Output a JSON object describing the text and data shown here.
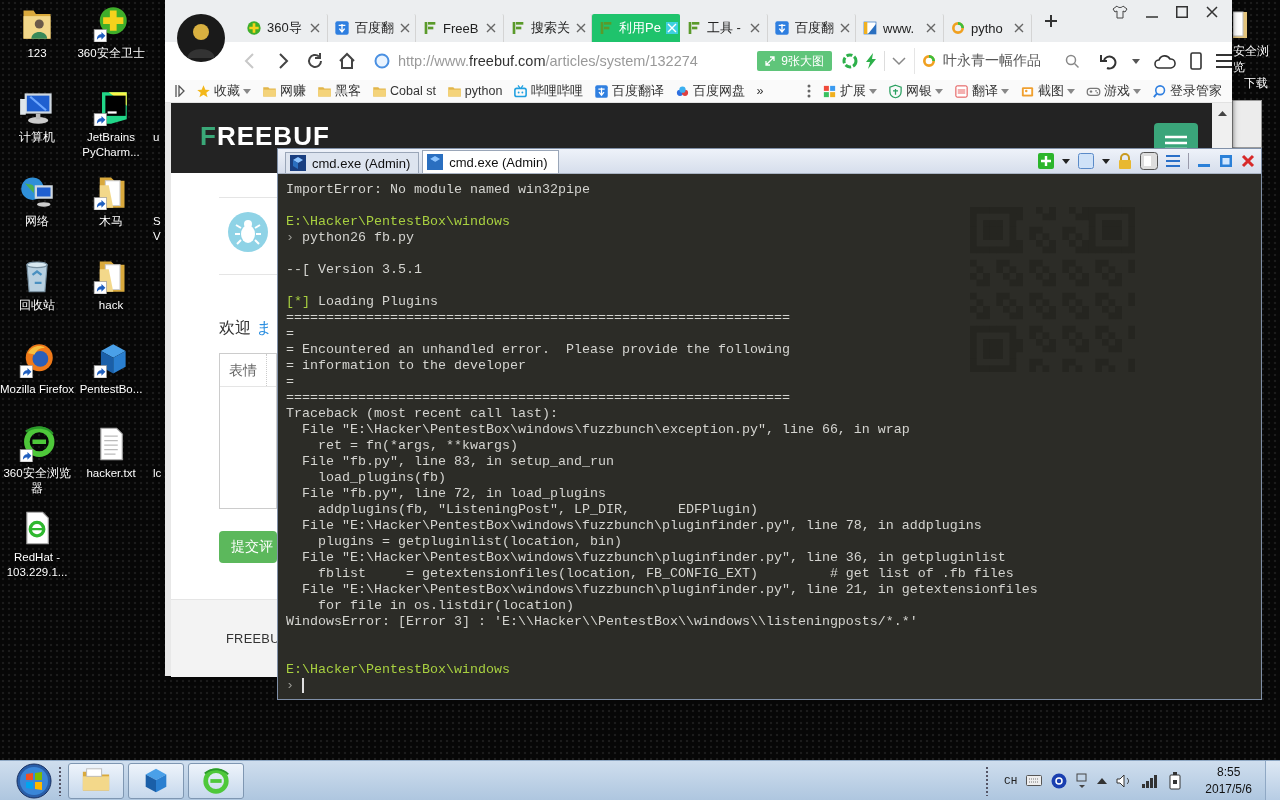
{
  "desktop": {
    "icons": [
      {
        "label": "123",
        "kind": "user-folder"
      },
      {
        "label": "360安全卫士",
        "kind": "shield"
      },
      {
        "label": "计算机",
        "kind": "computer"
      },
      {
        "label": "JetBrains PyCharm...",
        "kind": "ide"
      },
      {
        "label": "网络",
        "kind": "network"
      },
      {
        "label": "木马",
        "kind": "folder"
      },
      {
        "label": "回收站",
        "kind": "recycle"
      },
      {
        "label": "hack",
        "kind": "folder"
      },
      {
        "label": "Mozilla Firefox",
        "kind": "firefox"
      },
      {
        "label": "PentestBo...",
        "kind": "cube"
      },
      {
        "label": "360安全浏览器",
        "kind": "browser"
      },
      {
        "label": "hacker.txt",
        "kind": "text"
      },
      {
        "label": "RedHat - 103.229.1...",
        "kind": "page"
      }
    ],
    "covered_labels": [
      "u",
      "S V",
      "lc"
    ],
    "right_icon_lines": [
      "安全浏览",
      "下载"
    ]
  },
  "browser": {
    "tabs": [
      {
        "title": "360导",
        "kind": "shield",
        "selected": false
      },
      {
        "title": "百度翻",
        "kind": "translate",
        "selected": false
      },
      {
        "title": "FreeB",
        "kind": "bars",
        "selected": false
      },
      {
        "title": "搜索关",
        "kind": "bars",
        "selected": false
      },
      {
        "title": "利用Pe",
        "kind": "bars",
        "selected": true
      },
      {
        "title": "工具 -",
        "kind": "bars",
        "selected": false
      },
      {
        "title": "百度翻",
        "kind": "translate",
        "selected": false
      },
      {
        "title": "www.",
        "kind": "page",
        "selected": false
      },
      {
        "title": "pytho",
        "kind": "ring",
        "selected": false
      }
    ],
    "nav": [
      {
        "kind": "back",
        "disabled": true
      },
      {
        "kind": "forward",
        "disabled": false
      },
      {
        "kind": "refresh",
        "disabled": false
      },
      {
        "kind": "home",
        "disabled": false
      }
    ],
    "url": {
      "prefix": "http://www.",
      "domain": "freebuf.com",
      "path": "/articles/system/132274"
    },
    "image_badge": "9张大图",
    "search": {
      "value": "叶永青一幅作品"
    },
    "bookmarks": [
      {
        "label": "收藏",
        "kind": "star",
        "menu": true
      },
      {
        "label": "网赚",
        "kind": "folder",
        "menu": false
      },
      {
        "label": "黑客",
        "kind": "folder",
        "menu": false
      },
      {
        "label": "Cobal st",
        "kind": "folder",
        "menu": false
      },
      {
        "label": "python",
        "kind": "folder",
        "menu": false
      },
      {
        "label": "哔哩哔哩",
        "kind": "tv",
        "menu": false
      },
      {
        "label": "百度翻译",
        "kind": "translate",
        "menu": false
      },
      {
        "label": "百度网盘",
        "kind": "cloud",
        "menu": false
      }
    ],
    "bookmark_overflow": "»",
    "tools": [
      {
        "label": "扩展",
        "kind": "grid",
        "menu": true
      },
      {
        "label": "网银",
        "kind": "wallet",
        "menu": true
      },
      {
        "label": "翻译",
        "kind": "pdf",
        "menu": true
      },
      {
        "label": "截图",
        "kind": "crop",
        "menu": true
      },
      {
        "label": "游戏",
        "kind": "gamepad",
        "menu": true
      },
      {
        "label": "登录管家",
        "kind": "user",
        "menu": false
      }
    ],
    "page": {
      "logo": "FREEBUF",
      "greeting": "欢迎",
      "user_link": "ま",
      "editor_tabs": [
        "表情"
      ],
      "submit": "提交评",
      "footer": "FREEBU"
    }
  },
  "console": {
    "tabs": [
      {
        "title": "cmd.exe (Admin)",
        "selected": false
      },
      {
        "title": "cmd.exe (Admin)",
        "selected": true
      }
    ],
    "lines": [
      {
        "kind": "output",
        "text": "ImportError: No module named win32pipe"
      },
      {
        "kind": "blank"
      },
      {
        "kind": "path",
        "text": "E:\\Hacker\\PentestBox\\windows"
      },
      {
        "kind": "prompt",
        "prompt": "›",
        "text": "python26 fb.py",
        "cursor": false
      },
      {
        "kind": "blank"
      },
      {
        "kind": "output",
        "text": "--[ Version 3.5.1"
      },
      {
        "kind": "blank"
      },
      {
        "kind": "status",
        "marker": "[*]",
        "text": "Loading Plugins"
      },
      {
        "kind": "output",
        "text": "==============================================================="
      },
      {
        "kind": "output",
        "text": "="
      },
      {
        "kind": "output",
        "text": "= Encountered an unhandled error.  Please provide the following"
      },
      {
        "kind": "output",
        "text": "= information to the developer"
      },
      {
        "kind": "output",
        "text": "="
      },
      {
        "kind": "output",
        "text": "==============================================================="
      },
      {
        "kind": "output",
        "text": "Traceback (most recent call last):"
      },
      {
        "kind": "output",
        "text": "  File \"E:\\Hacker\\PentestBox\\windows\\fuzzbunch\\exception.py\", line 66, in wrap"
      },
      {
        "kind": "output",
        "text": "    ret = fn(*args, **kwargs)"
      },
      {
        "kind": "output",
        "text": "  File \"fb.py\", line 83, in setup_and_run"
      },
      {
        "kind": "output",
        "text": "    load_plugins(fb)"
      },
      {
        "kind": "output",
        "text": "  File \"fb.py\", line 72, in load_plugins"
      },
      {
        "kind": "output",
        "text": "    addplugins(fb, \"ListeningPost\", LP_DIR,      EDFPlugin)"
      },
      {
        "kind": "output",
        "text": "  File \"E:\\Hacker\\PentestBox\\windows\\fuzzbunch\\pluginfinder.py\", line 78, in addplugins"
      },
      {
        "kind": "output",
        "text": "    plugins = getpluginlist(location, bin)"
      },
      {
        "kind": "output",
        "text": "  File \"E:\\Hacker\\PentestBox\\windows\\fuzzbunch\\pluginfinder.py\", line 36, in getpluginlist"
      },
      {
        "kind": "output",
        "text": "    fblist     = getextensionfiles(location, FB_CONFIG_EXT)         # get list of .fb files"
      },
      {
        "kind": "output",
        "text": "  File \"E:\\Hacker\\PentestBox\\windows\\fuzzbunch\\pluginfinder.py\", line 21, in getextensionfiles"
      },
      {
        "kind": "output",
        "text": "    for file in os.listdir(location)"
      },
      {
        "kind": "output",
        "text": "WindowsError: [Error 3] : 'E:\\\\Hacker\\\\PentestBox\\\\windows\\\\listeningposts/*.*'"
      },
      {
        "kind": "blank"
      },
      {
        "kind": "blank"
      },
      {
        "kind": "path",
        "text": "E:\\Hacker\\PentestBox\\windows"
      },
      {
        "kind": "prompt",
        "prompt": "›",
        "cursor": true
      }
    ]
  },
  "taskbar": {
    "buttons": [
      {
        "kind": "explorer"
      },
      {
        "kind": "cube"
      },
      {
        "kind": "browser"
      }
    ],
    "tray": {
      "language": "CH",
      "time": "8:55",
      "date": "2017/5/6"
    }
  }
}
